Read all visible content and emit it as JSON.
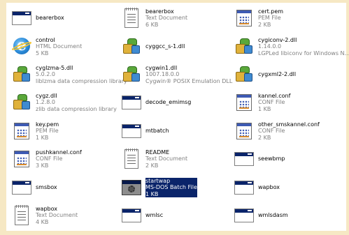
{
  "items": [
    {
      "name": "bearerbox",
      "type": "app",
      "meta": []
    },
    {
      "name": "bearerbox",
      "type": "doc",
      "meta": [
        "Text Document",
        "6 KB"
      ]
    },
    {
      "name": "cert.pem",
      "type": "cfg",
      "meta": [
        "PEM File",
        "2 KB"
      ]
    },
    {
      "name": "control",
      "type": "html",
      "meta": [
        "HTML Document",
        "5 KB"
      ]
    },
    {
      "name": "cyggcc_s-1.dll",
      "type": "dll",
      "meta": []
    },
    {
      "name": "cygiconv-2.dll",
      "type": "dll",
      "meta": [
        "1.14.0.0",
        "LGPLed libiconv for Windows N..."
      ]
    },
    {
      "name": "cyglzma-5.dll",
      "type": "dll",
      "meta": [
        "5.0.2.0",
        "liblzma data compression library"
      ]
    },
    {
      "name": "cygwin1.dll",
      "type": "dll",
      "meta": [
        "1007.18.0.0",
        "Cygwin® POSIX Emulation DLL"
      ]
    },
    {
      "name": "cygxml2-2.dll",
      "type": "dll",
      "meta": []
    },
    {
      "name": "cygz.dll",
      "type": "dll",
      "meta": [
        "1.2.8.0",
        "zlib data compression library"
      ]
    },
    {
      "name": "decode_emimsg",
      "type": "app",
      "meta": []
    },
    {
      "name": "kannel.conf",
      "type": "cfg",
      "meta": [
        "CONF File",
        "1 KB"
      ]
    },
    {
      "name": "key.pem",
      "type": "cfg",
      "meta": [
        "PEM File",
        "1 KB"
      ]
    },
    {
      "name": "mtbatch",
      "type": "app",
      "meta": []
    },
    {
      "name": "other_smskannel.conf",
      "type": "cfg",
      "meta": [
        "CONF File",
        "2 KB"
      ]
    },
    {
      "name": "pushkannel.conf",
      "type": "cfg",
      "meta": [
        "CONF File",
        "3 KB"
      ]
    },
    {
      "name": "README",
      "type": "doc",
      "meta": [
        "Text Document",
        "2 KB"
      ]
    },
    {
      "name": "seewbmp",
      "type": "app",
      "meta": []
    },
    {
      "name": "smsbox",
      "type": "app",
      "meta": []
    },
    {
      "name": "startwap",
      "type": "bat",
      "meta": [
        "MS-DOS Batch File",
        "1 KB"
      ],
      "selected": true
    },
    {
      "name": "wapbox",
      "type": "app",
      "meta": []
    },
    {
      "name": "wapbox",
      "type": "doc",
      "meta": [
        "Text Document",
        "4 KB"
      ]
    },
    {
      "name": "wmlsc",
      "type": "app",
      "meta": []
    },
    {
      "name": "wmlsdasm",
      "type": "app",
      "meta": []
    }
  ]
}
